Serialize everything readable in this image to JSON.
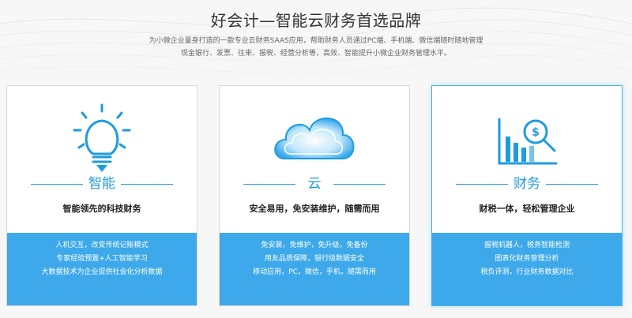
{
  "header": {
    "title": "好会计—智能云财务首选品牌",
    "subtitle": "为小微企业量身打造的一款专业云财务SAAS应用，帮助财务人员通过PC端、手机端、微信端随时随地管理现金银行、发票、往来、报税、经营分析等，高效、智能提升小微企业财务管理水平。"
  },
  "cards": [
    {
      "name": "智能",
      "icon": "lightbulb-icon",
      "headline": "智能领先的科技财务",
      "lines": [
        "人机交互，改变传统记账模式",
        "专家经验预置+人工智能学习",
        "大数据技术为企业提供社会化分析数据"
      ]
    },
    {
      "name": "云",
      "icon": "cloud-icon",
      "headline": "安全易用，免安装维护，随需而用",
      "lines": [
        "免安装，免维护，免升级，免备份",
        "用友品质保障，银行级数据安全",
        "移动应用，PC，微信，手机，随需而用"
      ]
    },
    {
      "name": "财务",
      "icon": "finance-chart-icon",
      "headline": "财税一体，轻松管理企业",
      "lines": [
        "报税机器人，税务智能检测",
        "图表化财务管理分析",
        "税负评测，行业财务数据对比"
      ]
    }
  ],
  "colors": {
    "accent": "#1e9be0",
    "panel": "#3ea9ea"
  }
}
